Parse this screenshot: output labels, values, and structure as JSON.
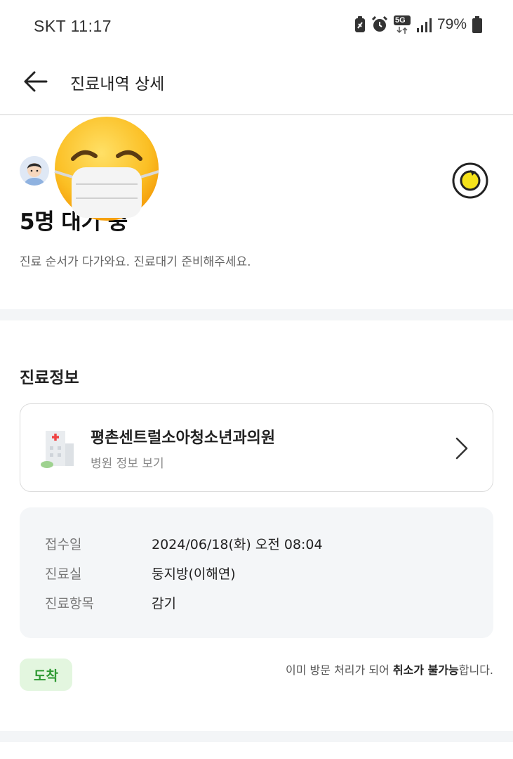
{
  "status_bar": {
    "carrier_time": "SKT 11:17",
    "network_label": "5G",
    "battery_percent": "79%",
    "icons": [
      "battery-saver-icon",
      "alarm-icon",
      "network-5g-icon",
      "signal-icon",
      "battery-icon"
    ]
  },
  "header": {
    "title": "진료내역 상세",
    "back_icon": "arrow-left-icon"
  },
  "queue": {
    "status_text": "5명 대기 중",
    "description": "진료 순서가 다가와요. 진료대기 준비해주세요.",
    "refresh_icon": "refresh-icon"
  },
  "treatment_info": {
    "section_title": "진료정보",
    "hospital": {
      "name": "평촌센트럴소아청소년과의원",
      "link_label": "병원 정보 보기"
    },
    "details": [
      {
        "key": "접수일",
        "value": "2024/06/18(화) 오전 08:04"
      },
      {
        "key": "진료실",
        "value": "둥지방(이해연)"
      },
      {
        "key": "진료항목",
        "value": "감기"
      }
    ],
    "status_badge": "도착",
    "cancel_note": {
      "prefix": "이미 방문 처리가 되어 ",
      "emphasis": "취소가 불가능",
      "suffix": "합니다."
    }
  },
  "colors": {
    "accent_green": "#2f9a33",
    "badge_bg": "#e3f6df",
    "refresh_yellow": "#f5e21a",
    "panel_gray": "#f4f6f8"
  }
}
